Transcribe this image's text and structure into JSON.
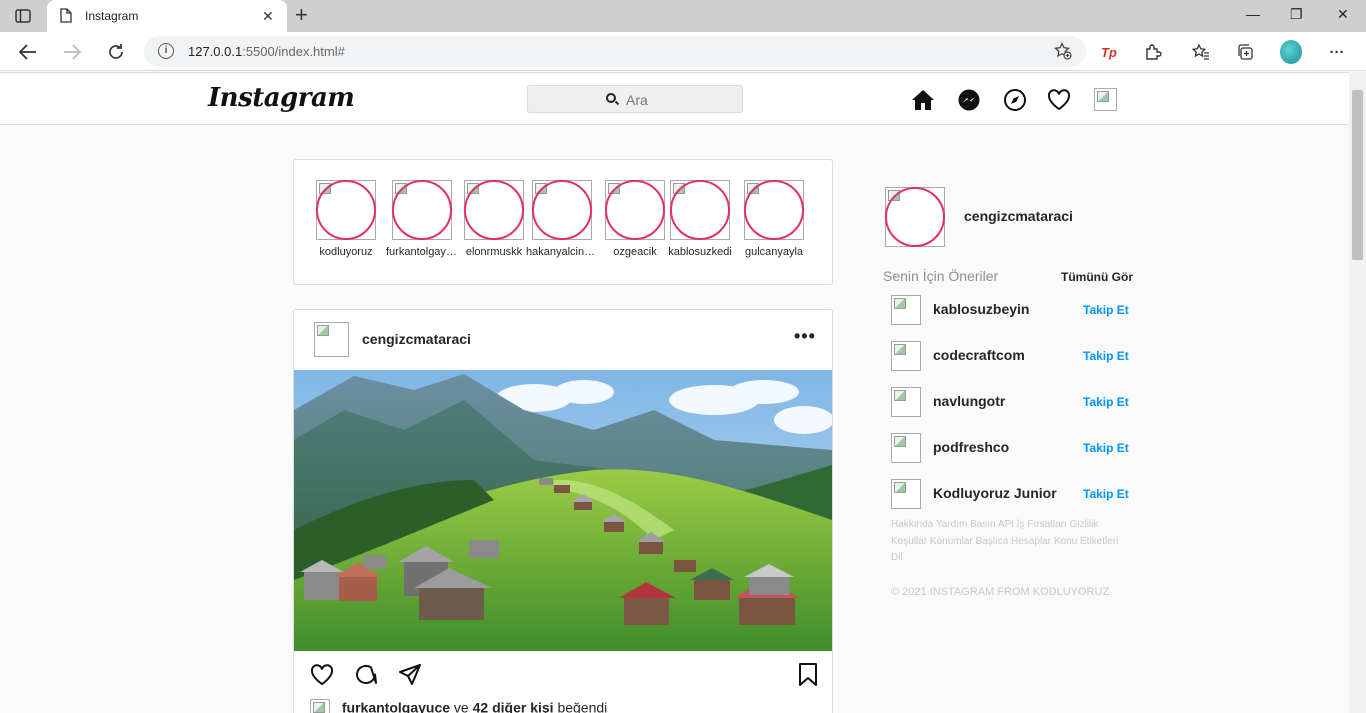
{
  "browser": {
    "tab_title": "Instagram",
    "url_host": "127.0.0.1",
    "url_rest": ":5500/index.html#",
    "new_tab_label": "+",
    "minimize": "—",
    "maximize": "❐",
    "close": "✕",
    "tp_label": "Tp",
    "more_label": "···"
  },
  "header": {
    "logo": "Instagram",
    "search_placeholder": "Ara",
    "nav_icons": [
      "home-icon",
      "messenger-icon",
      "explore-icon",
      "heart-icon",
      "profile-image"
    ]
  },
  "stories": [
    {
      "name": "kodluyoruz"
    },
    {
      "name": "furkantolgayuce"
    },
    {
      "name": "elonrmuskk"
    },
    {
      "name": "hakanyalcinkaya"
    },
    {
      "name": "ozgeacik"
    },
    {
      "name": "kablosuzkedi"
    },
    {
      "name": "gulcanyayla"
    }
  ],
  "post": {
    "username": "cengizcmataraci",
    "more": "•••",
    "liked_by_user": "furkantolgayuce",
    "liked_and": "ve",
    "liked_others": "42 diğer kişi",
    "liked_suffix": "beğendi"
  },
  "sidebar": {
    "username": "cengizcmataraci",
    "suggestions_title": "Senin İçin Öneriler",
    "see_all": "Tümünü Gör",
    "follow_label": "Takip Et",
    "suggestions": [
      {
        "name": "kablosuzbeyin"
      },
      {
        "name": "codecraftcom"
      },
      {
        "name": "navlungotr"
      },
      {
        "name": "podfreshco"
      },
      {
        "name": "Kodluyoruz Junior"
      }
    ],
    "footer_links": "Hakkında Yardım Basın API İş Fırsatları Gizlilik Koşullar Konumlar Başlıca Hesaplar Konu Etiketleri Dil",
    "copyright": "© 2021 INSTAGRAM FROM KODLUYORUZ"
  },
  "colors": {
    "story_ring": "#e1306c",
    "follow_link": "#0095f6",
    "page_bg": "#fafafa"
  }
}
